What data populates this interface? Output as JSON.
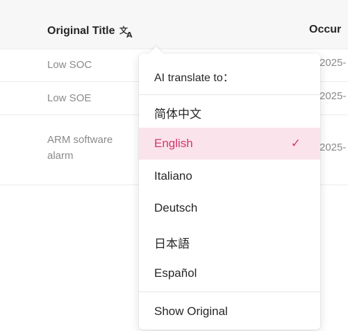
{
  "table": {
    "columns": {
      "title": "Original Title",
      "occurrence": "Occur"
    },
    "rows": [
      {
        "title": "Low SOC",
        "occurrence": "2025-"
      },
      {
        "title": "Low SOE",
        "occurrence": "2025-"
      },
      {
        "title": "ARM software alarm",
        "title_line1": "ARM software",
        "title_line2": "alarm",
        "occurrence": "2025-"
      }
    ]
  },
  "translate_menu": {
    "header": "AI translate to：",
    "options": [
      {
        "label": "简体中文",
        "selected": false
      },
      {
        "label": "English",
        "selected": true
      },
      {
        "label": "Italiano",
        "selected": false
      },
      {
        "label": "Deutsch",
        "selected": false
      },
      {
        "label": "日本語",
        "selected": false
      },
      {
        "label": "Español",
        "selected": false
      }
    ],
    "check_mark": "✓",
    "show_original": "Show Original"
  },
  "icons": {
    "translate": "translate-icon",
    "check": "check-icon"
  },
  "colors": {
    "accent": "#d6336c",
    "selected_bg": "#fbe3ec",
    "header_bg": "#f7f7f7"
  }
}
